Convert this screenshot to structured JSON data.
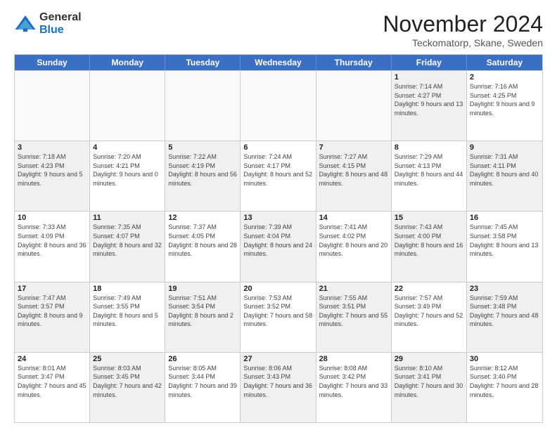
{
  "logo": {
    "general": "General",
    "blue": "Blue"
  },
  "title": "November 2024",
  "location": "Teckomatorp, Skane, Sweden",
  "days_of_week": [
    "Sunday",
    "Monday",
    "Tuesday",
    "Wednesday",
    "Thursday",
    "Friday",
    "Saturday"
  ],
  "weeks": [
    [
      {
        "day": "",
        "empty": true
      },
      {
        "day": "",
        "empty": true
      },
      {
        "day": "",
        "empty": true
      },
      {
        "day": "",
        "empty": true
      },
      {
        "day": "",
        "empty": true
      },
      {
        "day": "1",
        "sunrise": "Sunrise: 7:14 AM",
        "sunset": "Sunset: 4:27 PM",
        "daylight": "Daylight: 9 hours and 13 minutes.",
        "shaded": true
      },
      {
        "day": "2",
        "sunrise": "Sunrise: 7:16 AM",
        "sunset": "Sunset: 4:25 PM",
        "daylight": "Daylight: 9 hours and 9 minutes.",
        "shaded": false
      }
    ],
    [
      {
        "day": "3",
        "sunrise": "Sunrise: 7:18 AM",
        "sunset": "Sunset: 4:23 PM",
        "daylight": "Daylight: 9 hours and 5 minutes.",
        "shaded": true
      },
      {
        "day": "4",
        "sunrise": "Sunrise: 7:20 AM",
        "sunset": "Sunset: 4:21 PM",
        "daylight": "Daylight: 9 hours and 0 minutes.",
        "shaded": false
      },
      {
        "day": "5",
        "sunrise": "Sunrise: 7:22 AM",
        "sunset": "Sunset: 4:19 PM",
        "daylight": "Daylight: 8 hours and 56 minutes.",
        "shaded": true
      },
      {
        "day": "6",
        "sunrise": "Sunrise: 7:24 AM",
        "sunset": "Sunset: 4:17 PM",
        "daylight": "Daylight: 8 hours and 52 minutes.",
        "shaded": false
      },
      {
        "day": "7",
        "sunrise": "Sunrise: 7:27 AM",
        "sunset": "Sunset: 4:15 PM",
        "daylight": "Daylight: 8 hours and 48 minutes.",
        "shaded": true
      },
      {
        "day": "8",
        "sunrise": "Sunrise: 7:29 AM",
        "sunset": "Sunset: 4:13 PM",
        "daylight": "Daylight: 8 hours and 44 minutes.",
        "shaded": false
      },
      {
        "day": "9",
        "sunrise": "Sunrise: 7:31 AM",
        "sunset": "Sunset: 4:11 PM",
        "daylight": "Daylight: 8 hours and 40 minutes.",
        "shaded": true
      }
    ],
    [
      {
        "day": "10",
        "sunrise": "Sunrise: 7:33 AM",
        "sunset": "Sunset: 4:09 PM",
        "daylight": "Daylight: 8 hours and 36 minutes.",
        "shaded": false
      },
      {
        "day": "11",
        "sunrise": "Sunrise: 7:35 AM",
        "sunset": "Sunset: 4:07 PM",
        "daylight": "Daylight: 8 hours and 32 minutes.",
        "shaded": true
      },
      {
        "day": "12",
        "sunrise": "Sunrise: 7:37 AM",
        "sunset": "Sunset: 4:05 PM",
        "daylight": "Daylight: 8 hours and 28 minutes.",
        "shaded": false
      },
      {
        "day": "13",
        "sunrise": "Sunrise: 7:39 AM",
        "sunset": "Sunset: 4:04 PM",
        "daylight": "Daylight: 8 hours and 24 minutes.",
        "shaded": true
      },
      {
        "day": "14",
        "sunrise": "Sunrise: 7:41 AM",
        "sunset": "Sunset: 4:02 PM",
        "daylight": "Daylight: 8 hours and 20 minutes.",
        "shaded": false
      },
      {
        "day": "15",
        "sunrise": "Sunrise: 7:43 AM",
        "sunset": "Sunset: 4:00 PM",
        "daylight": "Daylight: 8 hours and 16 minutes.",
        "shaded": true
      },
      {
        "day": "16",
        "sunrise": "Sunrise: 7:45 AM",
        "sunset": "Sunset: 3:58 PM",
        "daylight": "Daylight: 8 hours and 13 minutes.",
        "shaded": false
      }
    ],
    [
      {
        "day": "17",
        "sunrise": "Sunrise: 7:47 AM",
        "sunset": "Sunset: 3:57 PM",
        "daylight": "Daylight: 8 hours and 9 minutes.",
        "shaded": true
      },
      {
        "day": "18",
        "sunrise": "Sunrise: 7:49 AM",
        "sunset": "Sunset: 3:55 PM",
        "daylight": "Daylight: 8 hours and 5 minutes.",
        "shaded": false
      },
      {
        "day": "19",
        "sunrise": "Sunrise: 7:51 AM",
        "sunset": "Sunset: 3:54 PM",
        "daylight": "Daylight: 8 hours and 2 minutes.",
        "shaded": true
      },
      {
        "day": "20",
        "sunrise": "Sunrise: 7:53 AM",
        "sunset": "Sunset: 3:52 PM",
        "daylight": "Daylight: 7 hours and 58 minutes.",
        "shaded": false
      },
      {
        "day": "21",
        "sunrise": "Sunrise: 7:55 AM",
        "sunset": "Sunset: 3:51 PM",
        "daylight": "Daylight: 7 hours and 55 minutes.",
        "shaded": true
      },
      {
        "day": "22",
        "sunrise": "Sunrise: 7:57 AM",
        "sunset": "Sunset: 3:49 PM",
        "daylight": "Daylight: 7 hours and 52 minutes.",
        "shaded": false
      },
      {
        "day": "23",
        "sunrise": "Sunrise: 7:59 AM",
        "sunset": "Sunset: 3:48 PM",
        "daylight": "Daylight: 7 hours and 48 minutes.",
        "shaded": true
      }
    ],
    [
      {
        "day": "24",
        "sunrise": "Sunrise: 8:01 AM",
        "sunset": "Sunset: 3:47 PM",
        "daylight": "Daylight: 7 hours and 45 minutes.",
        "shaded": false
      },
      {
        "day": "25",
        "sunrise": "Sunrise: 8:03 AM",
        "sunset": "Sunset: 3:45 PM",
        "daylight": "Daylight: 7 hours and 42 minutes.",
        "shaded": true
      },
      {
        "day": "26",
        "sunrise": "Sunrise: 8:05 AM",
        "sunset": "Sunset: 3:44 PM",
        "daylight": "Daylight: 7 hours and 39 minutes.",
        "shaded": false
      },
      {
        "day": "27",
        "sunrise": "Sunrise: 8:06 AM",
        "sunset": "Sunset: 3:43 PM",
        "daylight": "Daylight: 7 hours and 36 minutes.",
        "shaded": true
      },
      {
        "day": "28",
        "sunrise": "Sunrise: 8:08 AM",
        "sunset": "Sunset: 3:42 PM",
        "daylight": "Daylight: 7 hours and 33 minutes.",
        "shaded": false
      },
      {
        "day": "29",
        "sunrise": "Sunrise: 8:10 AM",
        "sunset": "Sunset: 3:41 PM",
        "daylight": "Daylight: 7 hours and 30 minutes.",
        "shaded": true
      },
      {
        "day": "30",
        "sunrise": "Sunrise: 8:12 AM",
        "sunset": "Sunset: 3:40 PM",
        "daylight": "Daylight: 7 hours and 28 minutes.",
        "shaded": false
      }
    ]
  ]
}
